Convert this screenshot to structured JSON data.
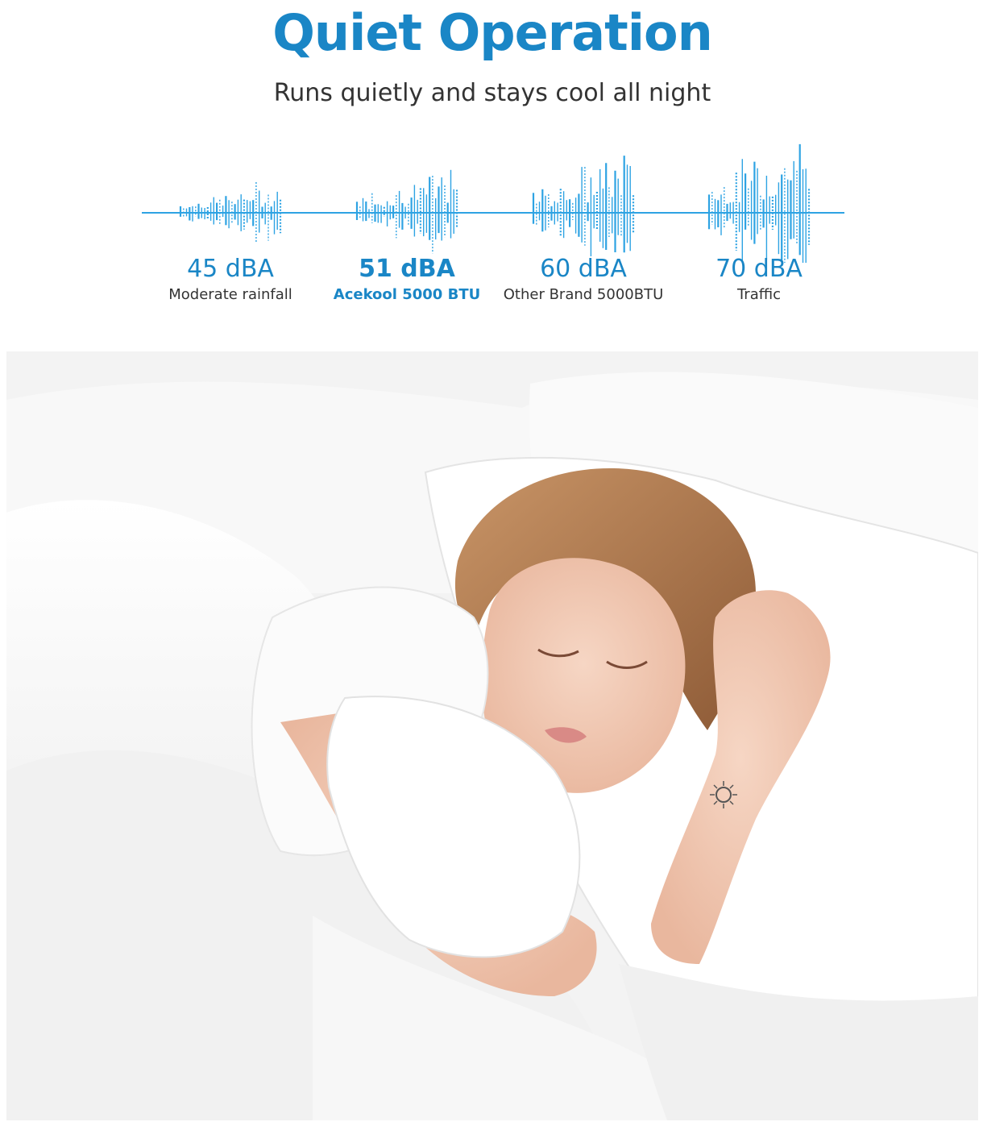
{
  "heading": {
    "title": "Quiet Operation",
    "subtitle": "Runs quietly and stays cool all night"
  },
  "colors": {
    "accent": "#1a86c6",
    "wave": "#2ea3e3",
    "text": "#333333"
  },
  "noise_levels": [
    {
      "value": "45 dBA",
      "label": "Moderate rainfall",
      "db": 45,
      "highlight": false
    },
    {
      "value": "51 dBA",
      "label": "Acekool 5000 BTU",
      "db": 51,
      "highlight": true
    },
    {
      "value": "60 dBA",
      "label": "Other Brand 5000BTU",
      "db": 60,
      "highlight": false
    },
    {
      "value": "70 dBA",
      "label": "Traffic",
      "db": 70,
      "highlight": false
    }
  ],
  "photo": {
    "subject": "woman-sleeping-in-bed-photo"
  }
}
